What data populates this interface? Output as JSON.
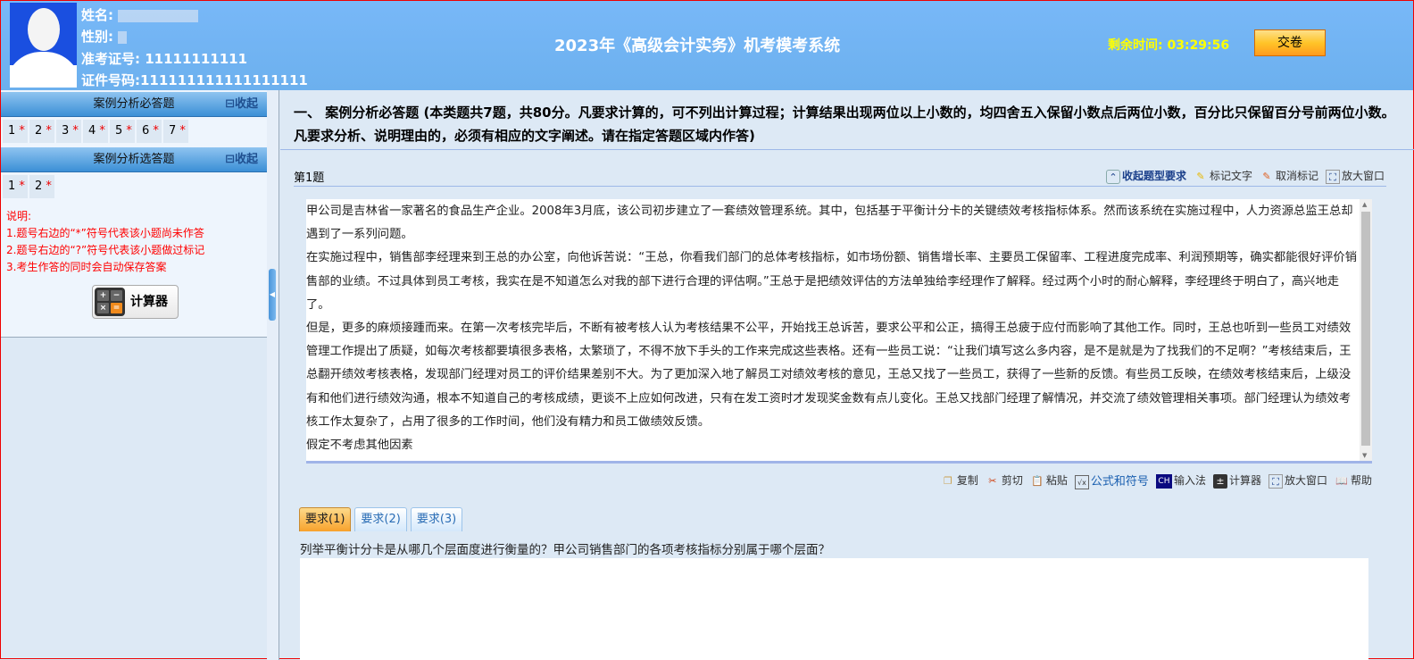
{
  "header": {
    "name_label": "姓名:",
    "gender_label": "性别:",
    "exam_id_label": "准考证号:",
    "exam_id": "11111111111",
    "cert_label": "证件号码:",
    "cert_no": "111111111111111111",
    "title": "2023年《高级会计实务》机考模考系统",
    "timer_label": "剩余时间:",
    "timer": "03:29:56",
    "submit": "交卷"
  },
  "sidebar": {
    "sections": [
      {
        "title": "案例分析必答题",
        "collapse": "⊟收起",
        "items": [
          "1",
          "2",
          "3",
          "4",
          "5",
          "6",
          "7"
        ]
      },
      {
        "title": "案例分析选答题",
        "collapse": "⊟收起",
        "items": [
          "1",
          "2"
        ]
      }
    ],
    "unanswered_mark": "*",
    "notes": [
      "说明:",
      "1.题号右边的“*”符号代表该小题尚未作答",
      "2.题号右边的“?”符号代表该小题做过标记",
      "3.考生作答的同时会自动保存答案"
    ],
    "calculator": "计算器"
  },
  "main": {
    "instructions": "一、 案例分析必答题 (本类题共7题，共80分。凡要求计算的，可不列出计算过程；计算结果出现两位以上小数的，均四舍五入保留小数点后两位小数，百分比只保留百分号前两位小数。凡要求分析、说明理由的，必须有相应的文字阐述。请在指定答题区域内作答)",
    "question_no": "第1题",
    "tools": {
      "collapse": "收起题型要求",
      "mark": "标记文字",
      "unmark": "取消标记",
      "maximize": "放大窗口"
    },
    "passage": [
      "甲公司是吉林省一家著名的食品生产企业。2008年3月底，该公司初步建立了一套绩效管理系统。其中，包括基于平衡计分卡的关键绩效考核指标体系。然而该系统在实施过程中，人力资源总监王总却遇到了一系列问题。",
      "在实施过程中，销售部李经理来到王总的办公室，向他诉苦说：“王总，你看我们部门的总体考核指标，如市场份额、销售增长率、主要员工保留率、工程进度完成率、利润预期等，确实都能很好评价销售部的业绩。不过具体到员工考核，我实在是不知道怎么对我的部下进行合理的评估啊。”王总于是把绩效评估的方法单独给李经理作了解释。经过两个小时的耐心解释，李经理终于明白了，高兴地走了。",
      "但是，更多的麻烦接踵而来。在第一次考核完毕后，不断有被考核人认为考核结果不公平，开始找王总诉苦，要求公平和公正，搞得王总疲于应付而影响了其他工作。同时，王总也听到一些员工对绩效管理工作提出了质疑，如每次考核都要填很多表格，太繁琐了，不得不放下手头的工作来完成这些表格。还有一些员工说：“让我们填写这么多内容，是不是就是为了找我们的不足啊？”考核结束后，王总翻开绩效考核表格，发现部门经理对员工的评价结果差别不大。为了更加深入地了解员工对绩效考核的意见，王总又找了一些员工，获得了一些新的反馈。有些员工反映，在绩效考核结束后，上级没有和他们进行绩效沟通，根本不知道自己的考核成绩，更谈不上应如何改进，只有在发工资时才发现奖金数有点儿变化。王总又找部门经理了解情况，并交流了绩效管理相关事项。部门经理认为绩效考核工作太复杂了，占用了很多的工作时间，他们没有精力和员工做绩效反馈。",
      "假定不考虑其他因素"
    ],
    "toolbar": {
      "copy": "复制",
      "cut": "剪切",
      "paste": "粘贴",
      "formula": "公式和符号",
      "ime": "输入法",
      "ime_icon": "CH",
      "calculator": "计算器",
      "maximize": "放大窗口",
      "help": "帮助"
    },
    "tabs": [
      "要求(1)",
      "要求(2)",
      "要求(3)"
    ],
    "question": "列举平衡计分卡是从哪几个层面度进行衡量的？甲公司销售部门的各项考核指标分别属于哪个层面？"
  }
}
